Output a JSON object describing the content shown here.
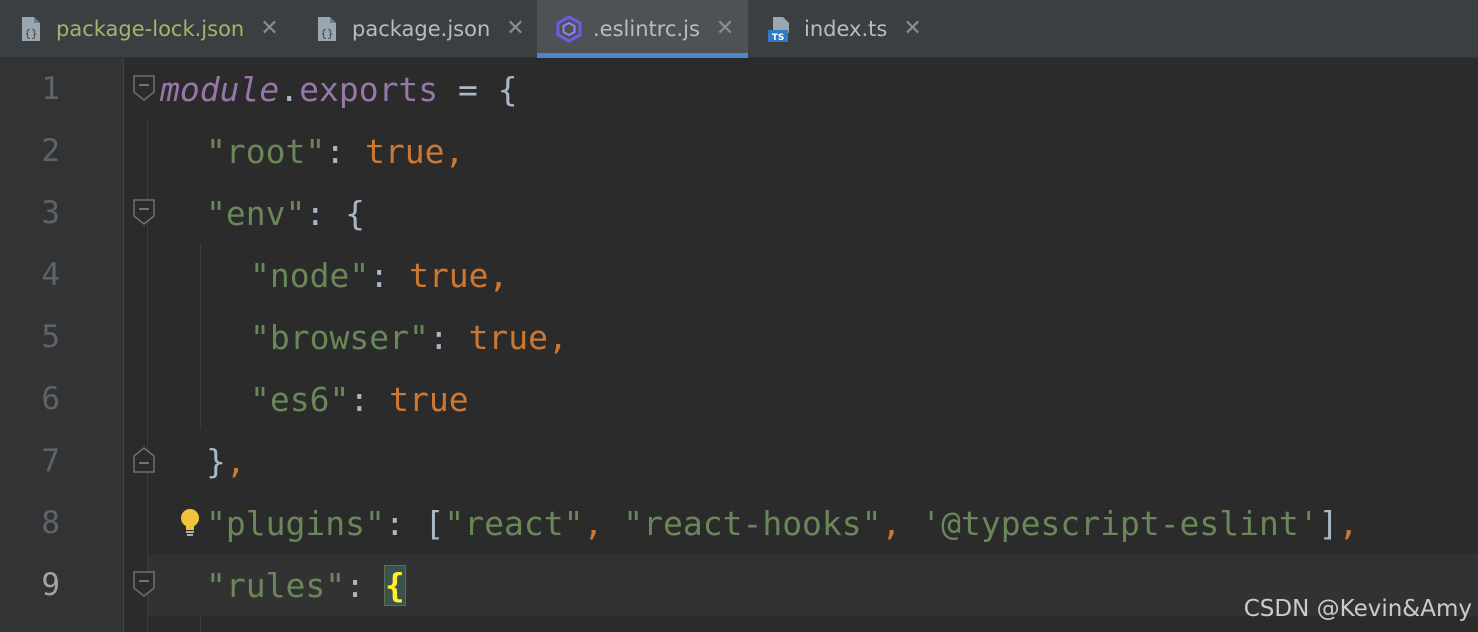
{
  "tabs": [
    {
      "label": "package-lock.json",
      "icon": "json-file-icon",
      "close": "✕",
      "active": false,
      "modified": true
    },
    {
      "label": "package.json",
      "icon": "json-file-icon",
      "close": "✕",
      "active": false,
      "modified": false
    },
    {
      "label": ".eslintrc.js",
      "icon": "eslint-icon",
      "close": "✕",
      "active": true,
      "modified": false
    },
    {
      "label": "index.ts",
      "icon": "typescript-file-icon",
      "close": "✕",
      "active": false,
      "modified": false
    }
  ],
  "editor": {
    "lines": [
      {
        "number": "1",
        "tokens": [
          [
            "module",
            "kw-italic"
          ],
          [
            ".",
            "punct"
          ],
          [
            "exports",
            "prop"
          ],
          [
            " = {",
            "punct"
          ]
        ]
      },
      {
        "number": "2",
        "tokens": [
          [
            "\"root\"",
            "str"
          ],
          [
            ": ",
            "punct"
          ],
          [
            "true",
            "bool"
          ],
          [
            ",",
            "comma"
          ]
        ]
      },
      {
        "number": "3",
        "tokens": [
          [
            "\"env\"",
            "str"
          ],
          [
            ": {",
            "punct"
          ]
        ]
      },
      {
        "number": "4",
        "tokens": [
          [
            "\"node\"",
            "str"
          ],
          [
            ": ",
            "punct"
          ],
          [
            "true",
            "bool"
          ],
          [
            ",",
            "comma"
          ]
        ]
      },
      {
        "number": "5",
        "tokens": [
          [
            "\"browser\"",
            "str"
          ],
          [
            ": ",
            "punct"
          ],
          [
            "true",
            "bool"
          ],
          [
            ",",
            "comma"
          ]
        ]
      },
      {
        "number": "6",
        "tokens": [
          [
            "\"es6\"",
            "str"
          ],
          [
            ": ",
            "punct"
          ],
          [
            "true",
            "bool"
          ]
        ]
      },
      {
        "number": "7",
        "tokens": [
          [
            "}",
            "punct"
          ],
          [
            ",",
            "comma"
          ]
        ]
      },
      {
        "number": "8",
        "tokens": [
          [
            "\"plugins\"",
            "str"
          ],
          [
            ": [",
            "punct"
          ],
          [
            "\"react\"",
            "str"
          ],
          [
            ", ",
            "comma"
          ],
          [
            "\"react-hooks\"",
            "str"
          ],
          [
            ", ",
            "comma"
          ],
          [
            "'@typescript-eslint'",
            "str"
          ],
          [
            "]",
            "punct"
          ],
          [
            ",",
            "comma"
          ]
        ]
      },
      {
        "number": "9",
        "tokens": [
          [
            "\"rules\"",
            "str"
          ],
          [
            ": ",
            "punct"
          ],
          [
            "{",
            "brace-match"
          ]
        ]
      }
    ],
    "caret_line": "9",
    "intention_bulb_line": "8"
  },
  "watermark": "CSDN @Kevin&Amy",
  "colors": {
    "background": "#2b2b2b",
    "gutter": "#313335",
    "tabbar": "#3c3f41",
    "active_tab_underline": "#4a88c7",
    "string": "#6a8759",
    "keyword": "#cc7832",
    "property": "#9876aa",
    "text": "#a9b7c6"
  }
}
